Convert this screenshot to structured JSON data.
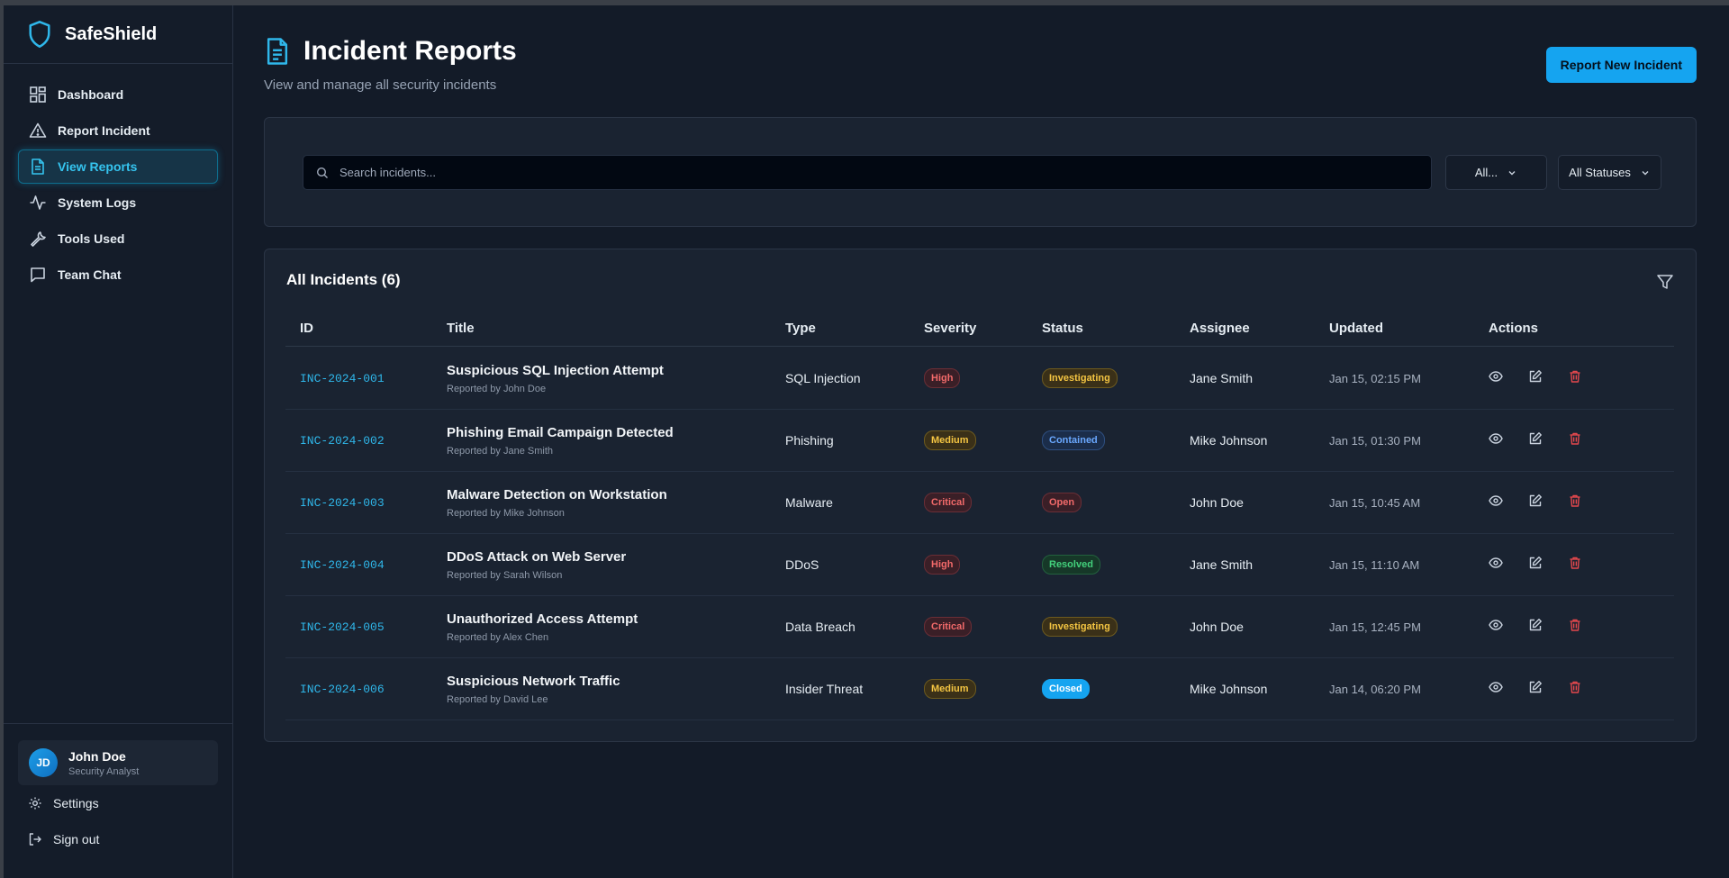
{
  "brand": {
    "name": "SafeShield"
  },
  "sidebar": {
    "items": [
      {
        "label": "Dashboard",
        "icon": "dashboard-icon"
      },
      {
        "label": "Report Incident",
        "icon": "alert-triangle-icon"
      },
      {
        "label": "View Reports",
        "icon": "file-text-icon",
        "active": true
      },
      {
        "label": "System Logs",
        "icon": "activity-icon"
      },
      {
        "label": "Tools Used",
        "icon": "wrench-icon"
      },
      {
        "label": "Team Chat",
        "icon": "chat-icon"
      }
    ],
    "user": {
      "initials": "JD",
      "name": "John Doe",
      "role": "Security Analyst"
    },
    "settings_label": "Settings",
    "signout_label": "Sign out"
  },
  "header": {
    "title": "Incident Reports",
    "subtitle": "View and manage all security incidents",
    "new_button": "Report New Incident"
  },
  "filters": {
    "search_placeholder": "Search incidents...",
    "type_value": "All...",
    "status_value": "All Statuses"
  },
  "table": {
    "title": "All Incidents (6)",
    "columns": [
      "ID",
      "Title",
      "Type",
      "Severity",
      "Status",
      "Assignee",
      "Updated",
      "Actions"
    ],
    "rows": [
      {
        "id": "INC-2024-001",
        "title": "Suspicious SQL Injection Attempt",
        "reporter": "Reported by John Doe",
        "type": "SQL Injection",
        "severity": "High",
        "status": "Investigating",
        "assignee": "Jane Smith",
        "updated": "Jan 15, 02:15 PM"
      },
      {
        "id": "INC-2024-002",
        "title": "Phishing Email Campaign Detected",
        "reporter": "Reported by Jane Smith",
        "type": "Phishing",
        "severity": "Medium",
        "status": "Contained",
        "assignee": "Mike Johnson",
        "updated": "Jan 15, 01:30 PM"
      },
      {
        "id": "INC-2024-003",
        "title": "Malware Detection on Workstation",
        "reporter": "Reported by Mike Johnson",
        "type": "Malware",
        "severity": "Critical",
        "status": "Open",
        "assignee": "John Doe",
        "updated": "Jan 15, 10:45 AM"
      },
      {
        "id": "INC-2024-004",
        "title": "DDoS Attack on Web Server",
        "reporter": "Reported by Sarah Wilson",
        "type": "DDoS",
        "severity": "High",
        "status": "Resolved",
        "assignee": "Jane Smith",
        "updated": "Jan 15, 11:10 AM"
      },
      {
        "id": "INC-2024-005",
        "title": "Unauthorized Access Attempt",
        "reporter": "Reported by Alex Chen",
        "type": "Data Breach",
        "severity": "Critical",
        "status": "Investigating",
        "assignee": "John Doe",
        "updated": "Jan 15, 12:45 PM"
      },
      {
        "id": "INC-2024-006",
        "title": "Suspicious Network Traffic",
        "reporter": "Reported by David Lee",
        "type": "Insider Threat",
        "severity": "Medium",
        "status": "Closed",
        "assignee": "Mike Johnson",
        "updated": "Jan 14, 06:20 PM"
      }
    ]
  },
  "colors": {
    "accent": "#15a4f0",
    "link": "#2fb7ea",
    "danger": "#f26a6a",
    "warning": "#f4c542",
    "success": "#43d17c"
  }
}
